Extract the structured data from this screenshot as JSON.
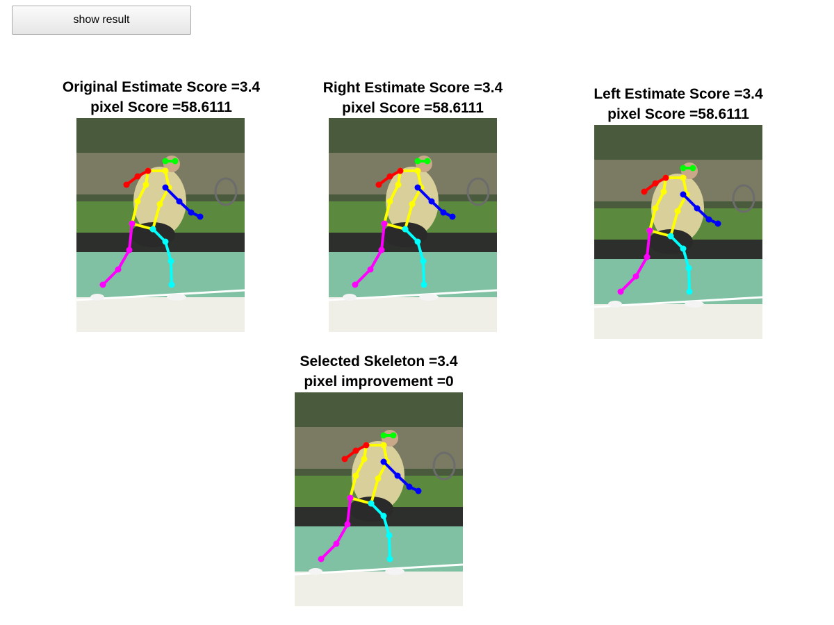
{
  "button": {
    "label": "show result"
  },
  "panels": [
    {
      "id": "original",
      "title_line1": "Original Estimate Score =3.4",
      "title_line2": "pixel Score =58.6111"
    },
    {
      "id": "right",
      "title_line1": "Right Estimate Score =3.4",
      "title_line2": "pixel Score =58.6111"
    },
    {
      "id": "left",
      "title_line1": "Left Estimate Score =3.4",
      "title_line2": "pixel Score =58.6111"
    },
    {
      "id": "selected",
      "title_line1": "Selected Skeleton =3.4",
      "title_line2": "pixel improvement =0"
    }
  ],
  "skeleton_colors": {
    "head": "#00ff00",
    "torso": "#ffff00",
    "left_arm": "#ff0000",
    "right_arm": "#0000ff",
    "left_leg": "#ff00ff",
    "right_leg": "#00ffff"
  }
}
